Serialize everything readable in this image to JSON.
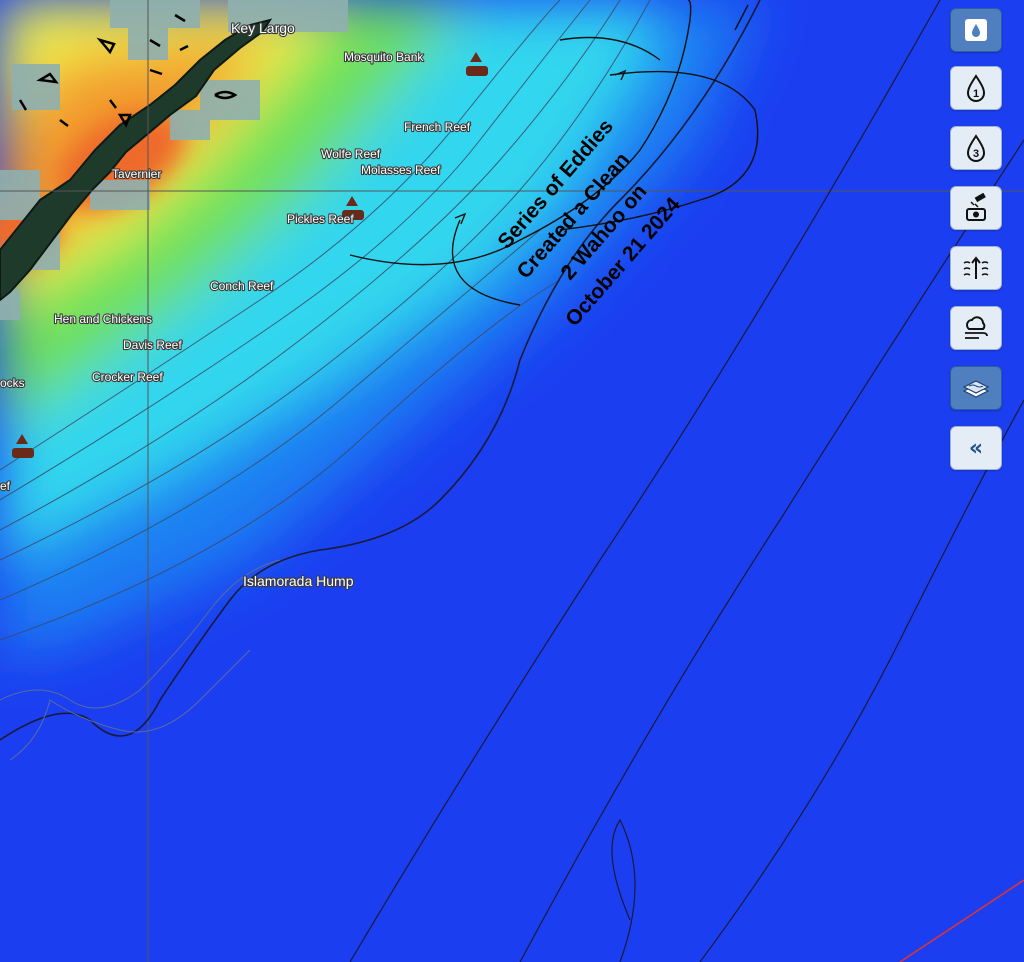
{
  "map": {
    "places": [
      {
        "id": "key-largo",
        "label": "Key Largo"
      },
      {
        "id": "mosquito-bank",
        "label": "Mosquito Bank"
      },
      {
        "id": "french-reef",
        "label": "French Reef"
      },
      {
        "id": "wolfe-reef",
        "label": "Wolfe Reef"
      },
      {
        "id": "molasses-reef",
        "label": "Molasses Reef"
      },
      {
        "id": "tavernier",
        "label": "Tavernier"
      },
      {
        "id": "pickles-reef",
        "label": "Pickles Reef"
      },
      {
        "id": "conch-reef",
        "label": "Conch Reef"
      },
      {
        "id": "hen-and-chickens",
        "label": "Hen and Chickens"
      },
      {
        "id": "davis-reef",
        "label": "Davis Reef"
      },
      {
        "id": "crocker-reef",
        "label": "Crocker Reef"
      },
      {
        "id": "rocks",
        "label": "ocks"
      },
      {
        "id": "reef-edge",
        "label": "ef"
      },
      {
        "id": "islamorada-hump",
        "label": "Islamorada Hump"
      }
    ],
    "annotation": {
      "lines": [
        "Series of Eddies",
        "Created a Clean",
        "2 Wahoo on",
        "October 21 2024"
      ]
    }
  },
  "toolbar": {
    "buttons": [
      {
        "id": "sst",
        "icon": "water-drop-icon"
      },
      {
        "id": "chlorophyll-1",
        "icon": "drop-1-icon",
        "text": "1"
      },
      {
        "id": "chlorophyll-3",
        "icon": "drop-3-icon",
        "text": "3"
      },
      {
        "id": "satellite",
        "icon": "satellite-camera-icon"
      },
      {
        "id": "currents",
        "icon": "currents-icon"
      },
      {
        "id": "weather",
        "icon": "weather-wind-icon"
      },
      {
        "id": "bathymetry",
        "icon": "bathymetry-icon"
      },
      {
        "id": "collapse",
        "icon": "chevron-double-left-icon",
        "text": "«"
      }
    ]
  },
  "colors": {
    "deep_blue": "#1b3ff0",
    "mid_blue": "#1f7ef2",
    "cyan": "#33d6ee",
    "green": "#6ee05a",
    "yellow": "#f2f24a",
    "orange": "#f29a2e",
    "land": "#1e3a2a",
    "shoal": "#8fb0b0",
    "accent": "#4f7fbf"
  }
}
